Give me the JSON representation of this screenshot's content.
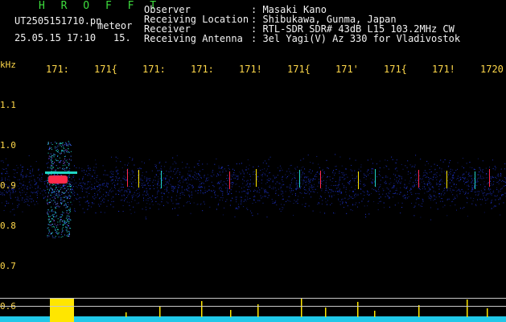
{
  "program": {
    "logo": "H R O F F T",
    "filename": "UT2505151710.pn",
    "meteor_label": "meteor",
    "datetime": "25.05.15 17:10",
    "count": "15."
  },
  "info": {
    "observer_label": "Observer",
    "observer_value": ": Masaki Kano",
    "location_label": "Receiving Location",
    "location_value": ": Shibukawa, Gunma, Japan",
    "receiver_label": "Receiver",
    "receiver_value": ": RTL-SDR SDR# 43dB L15 103.2MHz CW",
    "antenna_label": "Receiving Antenna",
    "antenna_value": ": 3el Yagi(V) Az 330 for Vladivostok"
  },
  "axes": {
    "y_unit": "kHz",
    "x_ticks": [
      "171:",
      "171{",
      "171:",
      "171:",
      "171!",
      "171{",
      "171'",
      "171{",
      "171!",
      "1720"
    ],
    "y_ticks": [
      "1.1",
      "1.0",
      "0.9",
      "0.8",
      "0.7",
      "0.6"
    ]
  },
  "colors": {
    "text": "#f2f2f2",
    "logo": "#3ddc3d",
    "ticks": "#ffd84a",
    "noise": "#2a3bd8",
    "signal_strong": "#ff2a4a",
    "signal_mid": "#21d6c5",
    "baseline": "#20c8e8",
    "spikes": "#ffe600"
  }
}
